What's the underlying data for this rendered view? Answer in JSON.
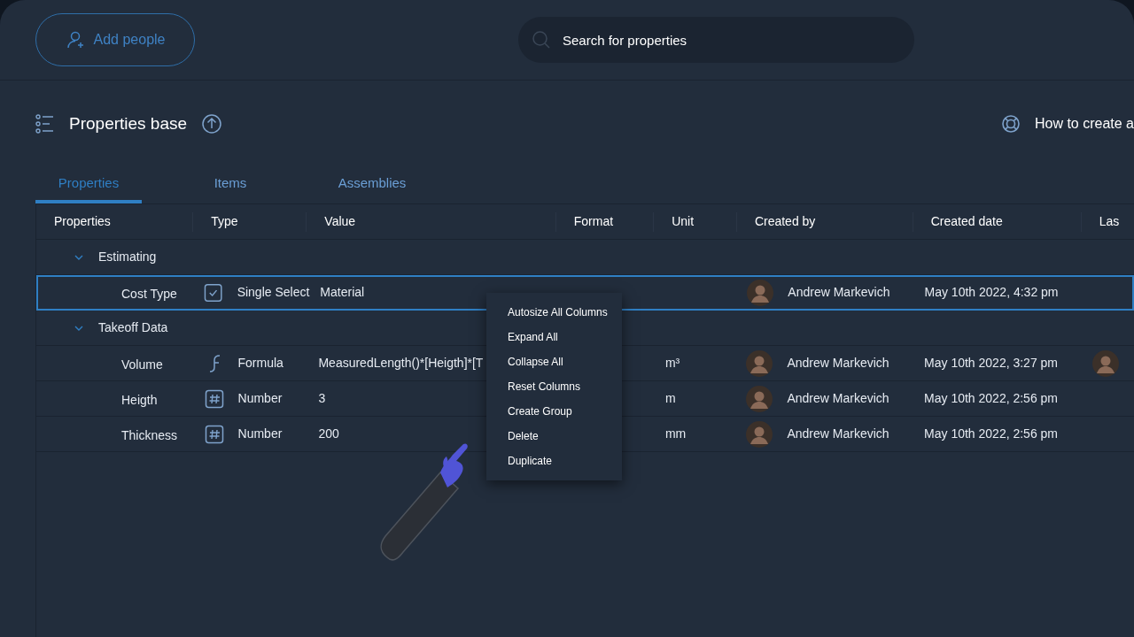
{
  "header": {
    "add_button": "Add people",
    "search": {
      "placeholder": "Search for properties"
    }
  },
  "title": "Properties base",
  "help_link": "How to create a",
  "tabs": [
    {
      "label": "Properties",
      "selected": true
    },
    {
      "label": "Items",
      "selected": false
    },
    {
      "label": "Assemblies",
      "selected": false
    }
  ],
  "table": {
    "columns": [
      "Properties",
      "Type",
      "Value",
      "Format",
      "Unit",
      "Created by",
      "Created date",
      "Las"
    ],
    "groups": [
      {
        "name": "Estimating",
        "expanded": true,
        "rows": [
          {
            "name": "Cost Type",
            "kind": "select",
            "type": "Single Select",
            "value": "Material",
            "unit": "",
            "created_by": "Andrew Markevich",
            "created_date": "May 10th 2022, 4:32 pm",
            "modified_avatar": false,
            "selected": true
          }
        ]
      },
      {
        "name": "Takeoff Data",
        "expanded": true,
        "rows": [
          {
            "name": "Volume",
            "kind": "formula",
            "type": "Formula",
            "value": "MeasuredLength()*[Heigth]*[T",
            "unit": "m³",
            "created_by": "Andrew Markevich",
            "created_date": "May 10th 2022, 3:27 pm",
            "modified_avatar": true,
            "selected": false
          },
          {
            "name": "Heigth",
            "kind": "number",
            "type": "Number",
            "value": "3",
            "unit": "m",
            "created_by": "Andrew Markevich",
            "created_date": "May 10th 2022, 2:56 pm",
            "modified_avatar": false,
            "selected": false
          },
          {
            "name": "Thickness",
            "kind": "number",
            "type": "Number",
            "value": "200",
            "unit": "mm",
            "created_by": "Andrew Markevich",
            "created_date": "May 10th 2022, 2:56 pm",
            "modified_avatar": false,
            "selected": false
          }
        ]
      }
    ]
  },
  "context_menu": [
    "Autosize All Columns",
    "Expand All",
    "Collapse All",
    "Reset Columns",
    "Create Group",
    "Delete",
    "Duplicate"
  ]
}
